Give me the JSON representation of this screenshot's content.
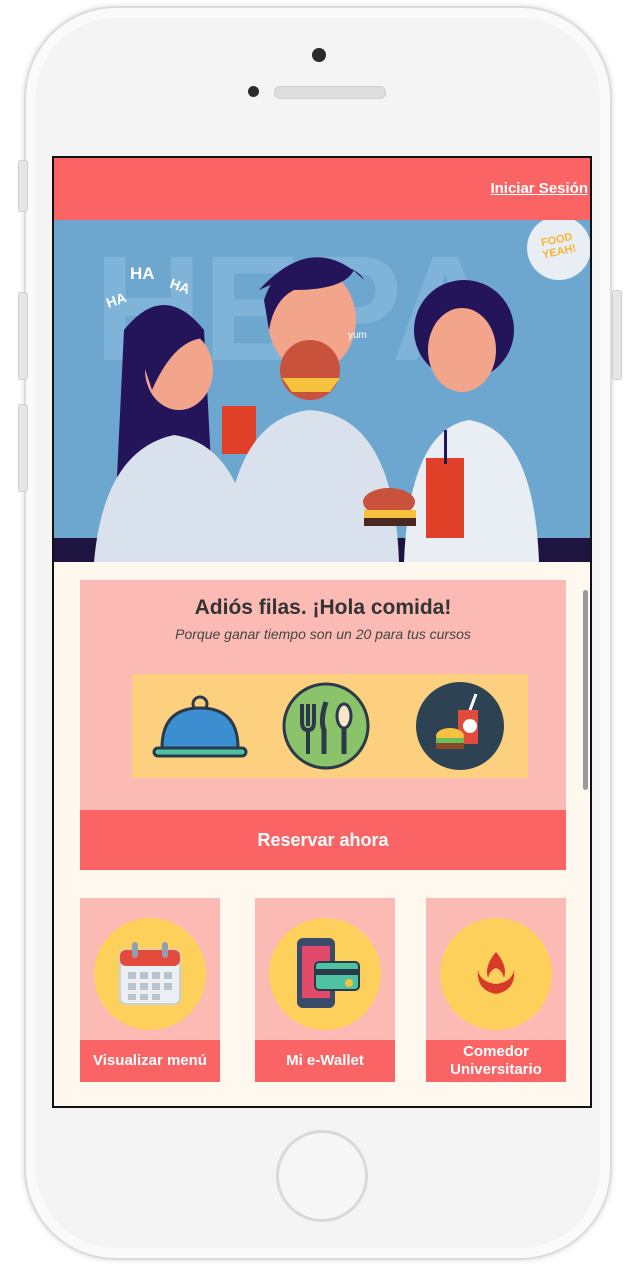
{
  "topbar": {
    "login_label": "Iniciar Sesión"
  },
  "hero": {
    "image_name": "friends-eating-illustration",
    "bubble_text": "FOOD YEAH!",
    "laugh_1": "HA",
    "laugh_2": "HA",
    "laugh_3": "HA",
    "yum": "yum"
  },
  "promo": {
    "title": "Adiós filas. ¡Hola comida!",
    "subtitle": "Porque ganar tiempo son un 20 para tus cursos",
    "icons": [
      "cloche-icon",
      "cutlery-icon",
      "burger-soda-icon"
    ]
  },
  "reserve": {
    "label": "Reservar ahora"
  },
  "cards": [
    {
      "label": "Visualizar menú",
      "icon": "calendar-icon"
    },
    {
      "label": "Mi e-Wallet",
      "icon": "phone-wallet-icon"
    },
    {
      "label": "Comedor Universitario",
      "icon": "upc-logo-icon"
    }
  ],
  "colors": {
    "accent": "#fa6464",
    "card_bg": "#fcbab4",
    "strip_bg": "#fdd080",
    "circle_bg": "#fdd05c",
    "page_bg": "#fff8ee",
    "hero_bg": "#6da6cf"
  }
}
